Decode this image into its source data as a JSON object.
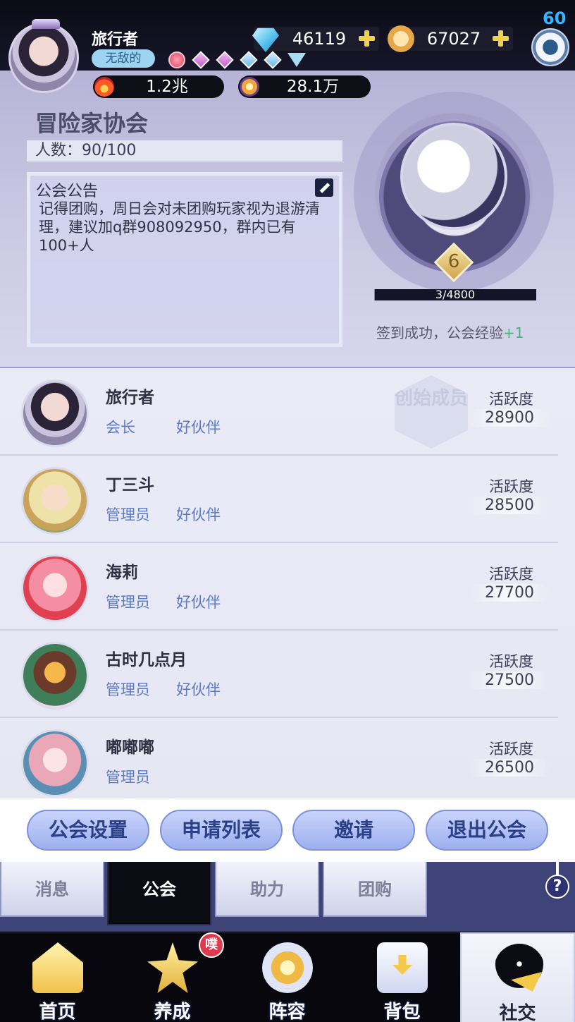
{
  "player": {
    "name": "旅行者",
    "title": "无敌的",
    "level": "60",
    "power": "1.2兆",
    "score": "28.1万"
  },
  "currencies": {
    "gems": "46119",
    "coins": "67027"
  },
  "guild": {
    "name": "冒险家协会",
    "member_count": "人数：90/100",
    "notice_title": "公会公告",
    "notice_text": "记得团购，周日会对未团购玩家视为退游清理，建议加q群908092950，群内已有100+人",
    "emblem_level": "6",
    "exp_text": "3/4800",
    "exp_fraction": 0.000625,
    "signin_text": "签到成功，公会经验",
    "signin_bonus": "+1"
  },
  "members": [
    {
      "name": "旅行者",
      "role": "会长",
      "tag": "好伙伴",
      "activity_label": "活跃度",
      "activity": "28900",
      "founder": "创始成员"
    },
    {
      "name": "丁三斗",
      "role": "管理员",
      "tag": "好伙伴",
      "activity_label": "活跃度",
      "activity": "28500"
    },
    {
      "name": "海莉",
      "role": "管理员",
      "tag": "好伙伴",
      "activity_label": "活跃度",
      "activity": "27700"
    },
    {
      "name": "古时几点月",
      "role": "管理员",
      "tag": "好伙伴",
      "activity_label": "活跃度",
      "activity": "27500"
    },
    {
      "name": "嘟嘟嘟",
      "role": "管理员",
      "tag": "",
      "activity_label": "活跃度",
      "activity": "26500"
    }
  ],
  "actions": {
    "settings": "公会设置",
    "applications": "申请列表",
    "invite": "邀请",
    "leave": "退出公会"
  },
  "subtabs": {
    "messages": "消息",
    "guild": "公会",
    "assist": "助力",
    "group_buy": "团购"
  },
  "nav": {
    "home": "首页",
    "train": "养成",
    "team": "阵容",
    "bag": "背包",
    "social": "社交",
    "badge": "噗"
  },
  "colors": {
    "accent_blue": "#5b79c4",
    "button_text": "#2b3f86",
    "level_blue": "#33b6ff",
    "bonus_green": "#46b47a"
  }
}
